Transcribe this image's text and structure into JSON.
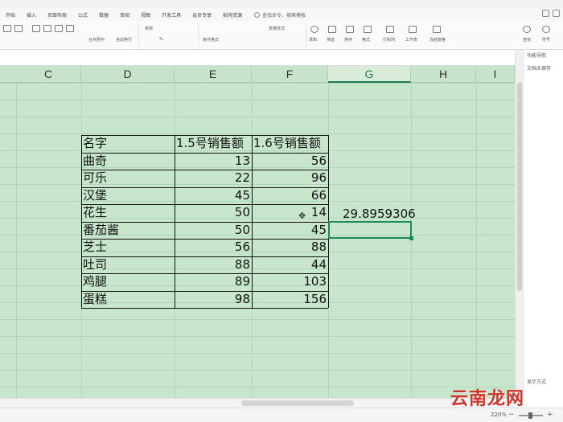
{
  "menu": {
    "tabs": [
      "开始",
      "插入",
      "页面布局",
      "公式",
      "数据",
      "审阅",
      "视图",
      "开发工具",
      "会员专享",
      "稻壳资源"
    ],
    "search_label": "查找命令、搜索模板"
  },
  "ribbon": {
    "font_name": "常规",
    "number_format": "常规",
    "labels": [
      "合并居中",
      "自动换行",
      "条件格式",
      "表格样式",
      "求和",
      "筛选",
      "排序",
      "格式",
      "行和列",
      "工作表",
      "冻结窗格",
      "查找",
      "符号"
    ]
  },
  "columns": [
    "C",
    "D",
    "E",
    "F",
    "G",
    "H",
    "I"
  ],
  "selected_column": "G",
  "table": {
    "headers": [
      "名字",
      "1.5号销售额",
      "1.6号销售额"
    ],
    "rows": [
      {
        "name": "曲奇",
        "d15": "13",
        "d16": "56"
      },
      {
        "name": "可乐",
        "d15": "22",
        "d16": "96"
      },
      {
        "name": "汉堡",
        "d15": "45",
        "d16": "66"
      },
      {
        "name": "花生",
        "d15": "50",
        "d16": "14"
      },
      {
        "name": "番茄酱",
        "d15": "50",
        "d16": "45"
      },
      {
        "name": "芝士",
        "d15": "56",
        "d16": "88"
      },
      {
        "name": "吐司",
        "d15": "88",
        "d16": "44"
      },
      {
        "name": "鸡腿",
        "d15": "89",
        "d16": "103"
      },
      {
        "name": "蛋糕",
        "d15": "98",
        "d16": "156"
      }
    ]
  },
  "result_value": "29.8959306",
  "side_panel": {
    "title": "功能导航",
    "item": "文档未保存",
    "bottom": "显示方式"
  },
  "status": {
    "zoom": "220%",
    "zoom_minus": "−",
    "zoom_plus": "+"
  },
  "watermark": "云南龙网",
  "colors": {
    "sheet_bg": "#c7e6cc",
    "selection": "#1e8a5a"
  }
}
